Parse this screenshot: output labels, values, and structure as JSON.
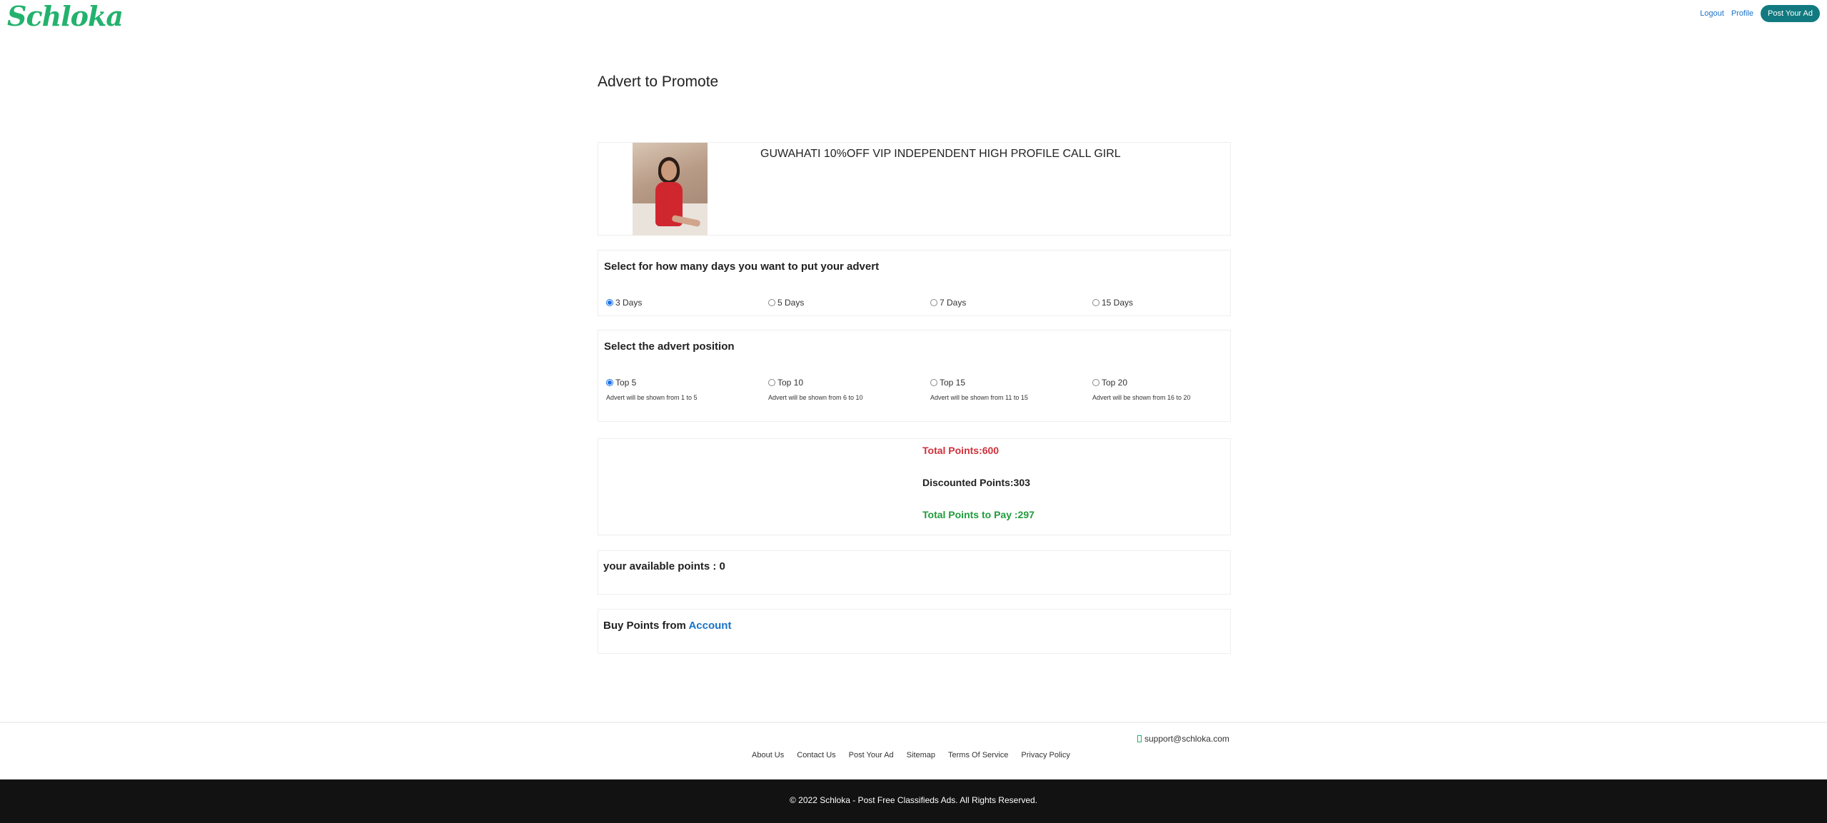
{
  "header": {
    "logo": "Schloka",
    "nav": {
      "logout": "Logout",
      "profile": "Profile",
      "post_ad": "Post Your Ad"
    }
  },
  "page": {
    "title": "Advert to Promote"
  },
  "ad": {
    "title": "GUWAHATI 10%OFF VIP INDEPENDENT HIGH PROFILE CALL GIRL"
  },
  "days": {
    "title": "Select for how many days you want to put your advert",
    "options": [
      {
        "label": "3 Days",
        "checked": true
      },
      {
        "label": "5 Days",
        "checked": false
      },
      {
        "label": "7 Days",
        "checked": false
      },
      {
        "label": "15 Days",
        "checked": false
      }
    ]
  },
  "position": {
    "title": "Select the advert position",
    "options": [
      {
        "label": "Top 5",
        "desc": "Advert will be shown from 1 to 5",
        "checked": true
      },
      {
        "label": "Top 10",
        "desc": "Advert will be shown from 6 to 10",
        "checked": false
      },
      {
        "label": "Top 15",
        "desc": "Advert will be shown from 11 to 15",
        "checked": false
      },
      {
        "label": "Top 20",
        "desc": "Advert will be shown from 16 to 20",
        "checked": false
      }
    ]
  },
  "points": {
    "total": "Total Points:600",
    "discounted": "Discounted Points:303",
    "to_pay": "Total Points to Pay :297"
  },
  "available": {
    "text": "your available points : 0"
  },
  "buy": {
    "prefix": "Buy Points from",
    "link": "Account"
  },
  "footer": {
    "support_email": "support@schloka.com",
    "links": [
      "About Us",
      "Contact Us",
      "Post Your Ad",
      "Sitemap",
      "Terms Of Service",
      "Privacy Policy"
    ],
    "copyright": "© 2022 Schloka - Post Free Classifieds Ads. All Rights Reserved."
  },
  "colors": {
    "brand_green": "#23b26d",
    "post_button": "#117a80",
    "total_points_red": "#d0303a",
    "pay_points_green": "#1f9c3b",
    "link_blue": "#1a73c8"
  }
}
